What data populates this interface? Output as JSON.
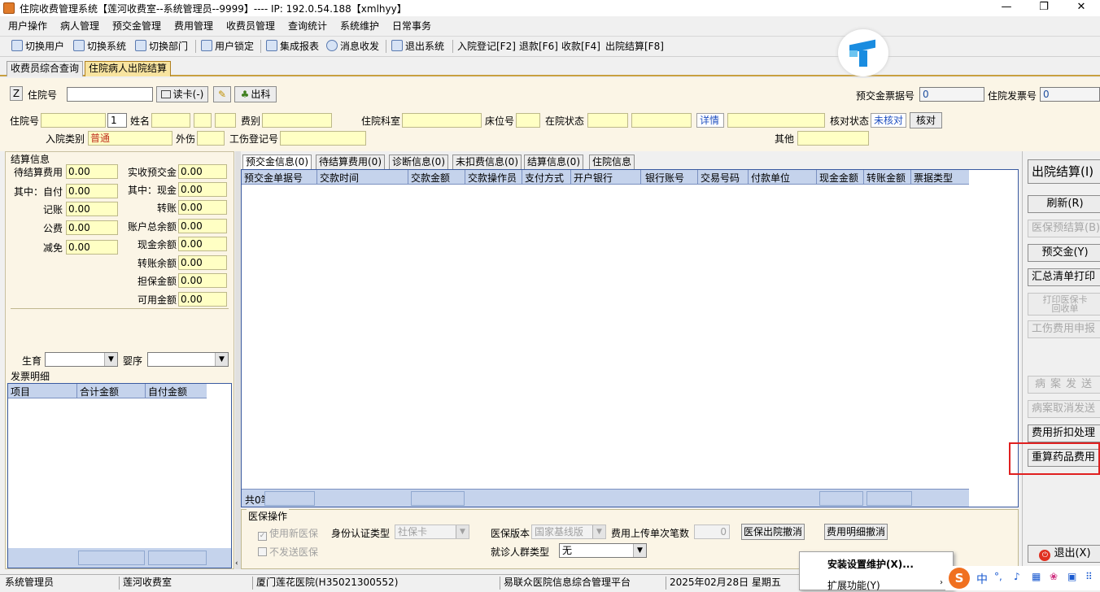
{
  "window": {
    "title": "住院收费管理系统【莲河收费室--系统管理员--9999】---- IP: 192.0.54.188【xmlhyy】",
    "minimize": "—",
    "maximize": "❐",
    "close": "✕"
  },
  "menu": [
    "用户操作",
    "病人管理",
    "预交金管理",
    "费用管理",
    "收费员管理",
    "查询统计",
    "系统维护",
    "日常事务"
  ],
  "toolbar": [
    "切换用户",
    "切换系统",
    "切换部门",
    "用户锁定",
    "集成报表",
    "消息收发",
    "退出系统",
    "入院登记[F2]",
    "退款[F6]",
    "收款[F4]",
    "出院结算[F8]"
  ],
  "doc_tabs": [
    "收费员综合查询",
    "住院病人出院结算"
  ],
  "form": {
    "z_button": "Z",
    "zyh_label": "住院号",
    "read_card": "读卡(-)",
    "out_dept": "出科",
    "prepay_receipt_label": "预交金票据号",
    "prepay_receipt_value": "0",
    "inv_label": "住院发票号",
    "inv_value": "0",
    "zyh2_label": "住院号",
    "zyh2_small": "1",
    "name_label": "姓名",
    "feetype_label": "费别",
    "dept_label": "住院科室",
    "bed_label": "床位号",
    "status_label": "在院状态",
    "detail_btn": "详情",
    "check_status_label": "核对状态",
    "check_status_value": "未核对",
    "check_btn": "核对",
    "admit_type_label": "入院类别",
    "admit_type_value": "普通",
    "injury_label": "外伤",
    "work_injury_label": "工伤登记号",
    "other_label": "其他"
  },
  "settlement": {
    "group_title": "结算信息",
    "left": [
      {
        "label": "待结算费用",
        "value": "0.00"
      },
      {
        "label": "其中：自付",
        "value": "0.00"
      },
      {
        "label": "记账",
        "value": "0.00"
      },
      {
        "label": "公费",
        "value": "0.00"
      },
      {
        "label": "减免",
        "value": "0.00"
      }
    ],
    "right": [
      {
        "label": "实收预交金",
        "value": "0.00"
      },
      {
        "label": "其中：现金",
        "value": "0.00"
      },
      {
        "label": "转账",
        "value": "0.00"
      },
      {
        "label": "账户总余额",
        "value": "0.00"
      },
      {
        "label": "现金余额",
        "value": "0.00"
      },
      {
        "label": "转账余额",
        "value": "0.00"
      },
      {
        "label": "担保金额",
        "value": "0.00"
      },
      {
        "label": "可用金额",
        "value": "0.00"
      }
    ],
    "birth_label": "生育",
    "order_label": "婴序"
  },
  "invoice": {
    "title": "发票明细",
    "columns": [
      "项目",
      "合计金额",
      "自付金额"
    ]
  },
  "content_tabs": [
    "预交金信息(0)",
    "待结算费用(0)",
    "诊断信息(0)",
    "未扣费信息(0)",
    "结算信息(0)",
    "住院信息"
  ],
  "grid": {
    "columns": [
      "预交金单据号",
      "交款时间",
      "交款金额",
      "交款操作员",
      "支付方式",
      "开户银行",
      "银行账号",
      "交易号码",
      "付款单位",
      "现金金额",
      "转账金额",
      "票据类型"
    ],
    "footer_count": "共0笔"
  },
  "insurance": {
    "title": "医保操作",
    "use_new": "使用新医保",
    "no_send": "不发送医保",
    "id_type_label": "身份认证类型",
    "id_type_value": "社保卡",
    "version_label": "医保版本",
    "version_value": "国家基线版",
    "upload_label": "费用上传单次笔数",
    "upload_value": "0",
    "cancel_discharge": "医保出院撤消",
    "cancel_detail": "费用明细撤消",
    "crowd_label": "就诊人群类型",
    "crowd_value": "无"
  },
  "right_buttons": [
    {
      "label": "出院结算(I)",
      "enabled": true
    },
    {
      "label": "刷新(R)",
      "enabled": true
    },
    {
      "label": "医保预结算(B)",
      "enabled": false
    },
    {
      "label": "预交金(Y)",
      "enabled": true
    },
    {
      "label": "汇总清单打印",
      "enabled": true
    },
    {
      "label": "打印医保卡回收单",
      "enabled": false
    },
    {
      "label": "工伤费用申报",
      "enabled": false
    },
    {
      "label": "病案发送",
      "enabled": false
    },
    {
      "label": "病案取消发送",
      "enabled": false
    },
    {
      "label": "费用折扣处理",
      "enabled": true
    },
    {
      "label": "重算药品费用",
      "enabled": true
    }
  ],
  "exit_button": "退出(X)",
  "context_menu": [
    "安装设置维护(X)...",
    "扩展功能(Y)"
  ],
  "status": [
    "系统管理员",
    "莲河收费室",
    "厦门莲花医院(H35021300552)",
    "易联众医院信息综合管理平台",
    "2025年02月28日 星期五"
  ],
  "ime": "中"
}
